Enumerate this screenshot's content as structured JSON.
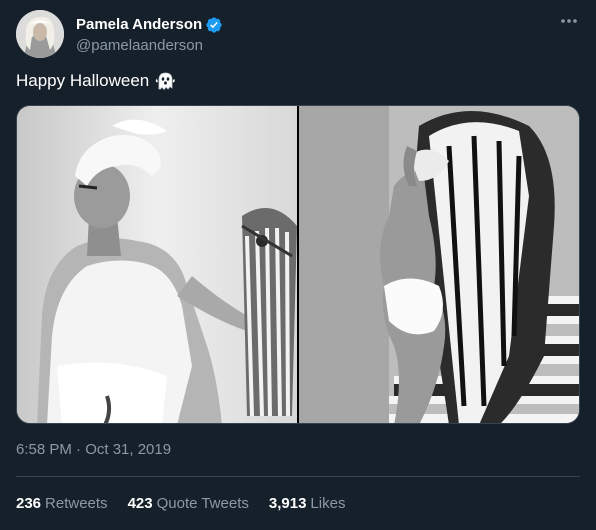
{
  "author": {
    "display_name": "Pamela Anderson",
    "handle": "@pamelaanderson",
    "verified": true,
    "avatar": "profile-photo"
  },
  "tweet": {
    "text": "Happy Halloween",
    "emoji": "ghost-emoji",
    "timestamp": "6:58 PM · Oct 31, 2019"
  },
  "media": {
    "count": 2,
    "images": [
      "photo-left",
      "photo-right"
    ]
  },
  "stats": {
    "retweets": {
      "count": "236",
      "label": "Retweets"
    },
    "quote_tweets": {
      "count": "423",
      "label": "Quote Tweets"
    },
    "likes": {
      "count": "3,913",
      "label": "Likes"
    }
  },
  "colors": {
    "background": "#15202b",
    "secondary_text": "#8b98a5",
    "divider": "#38444d",
    "verified_blue": "#1d9bf0"
  }
}
